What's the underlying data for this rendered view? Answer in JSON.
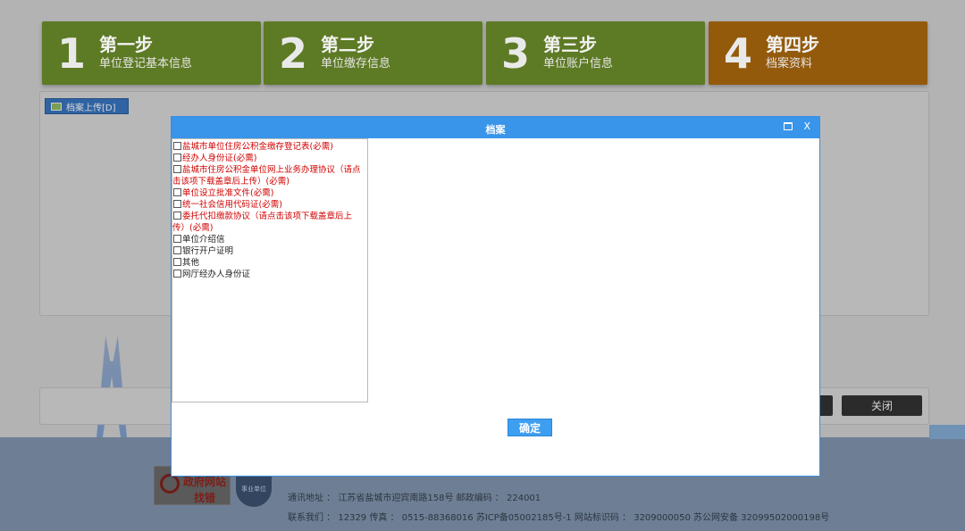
{
  "steps": [
    {
      "num": "1",
      "title": "第一步",
      "sub": "单位登记基本信息"
    },
    {
      "num": "2",
      "title": "第二步",
      "sub": "单位缴存信息"
    },
    {
      "num": "3",
      "title": "第三步",
      "sub": "单位账户信息"
    },
    {
      "num": "4",
      "title": "第四步",
      "sub": "档案资料"
    }
  ],
  "upload_label": "档案上传[D]",
  "close_label": "关闭",
  "modal": {
    "title": "档案",
    "close": "X",
    "confirm": "确定",
    "items": [
      {
        "label": "盐城市单位住房公积金缴存登记表(必需)",
        "required": true
      },
      {
        "label": "经办人身份证(必需)",
        "required": true
      },
      {
        "label": "盐城市住房公积金单位网上业务办理协议（请点击该项下载盖章后上传）(必需)",
        "required": true
      },
      {
        "label": "单位设立批准文件(必需)",
        "required": true
      },
      {
        "label": "统一社会信用代码证(必需)",
        "required": true
      },
      {
        "label": "委托代扣缴款协议（请点击该项下载盖章后上传）(必需)",
        "required": true
      },
      {
        "label": "单位介绍信",
        "required": false
      },
      {
        "label": "银行开户证明",
        "required": false
      },
      {
        "label": "其他",
        "required": false
      },
      {
        "label": "网厅经办人身份证",
        "required": false
      }
    ]
  },
  "footer": {
    "gov_logo_line1": "政府网站",
    "gov_logo_line2": "找错",
    "shield_text": "事业单位",
    "address": "通讯地址 ： 江苏省盐城市迎宾南路158号        邮政编码 ： 224001",
    "contact": "联系我们 ： 12329 传真 ： 0515-88368016     苏ICP备05002185号-1 网站标识码 ： 3209000050 苏公网安备 32099502000198号"
  }
}
